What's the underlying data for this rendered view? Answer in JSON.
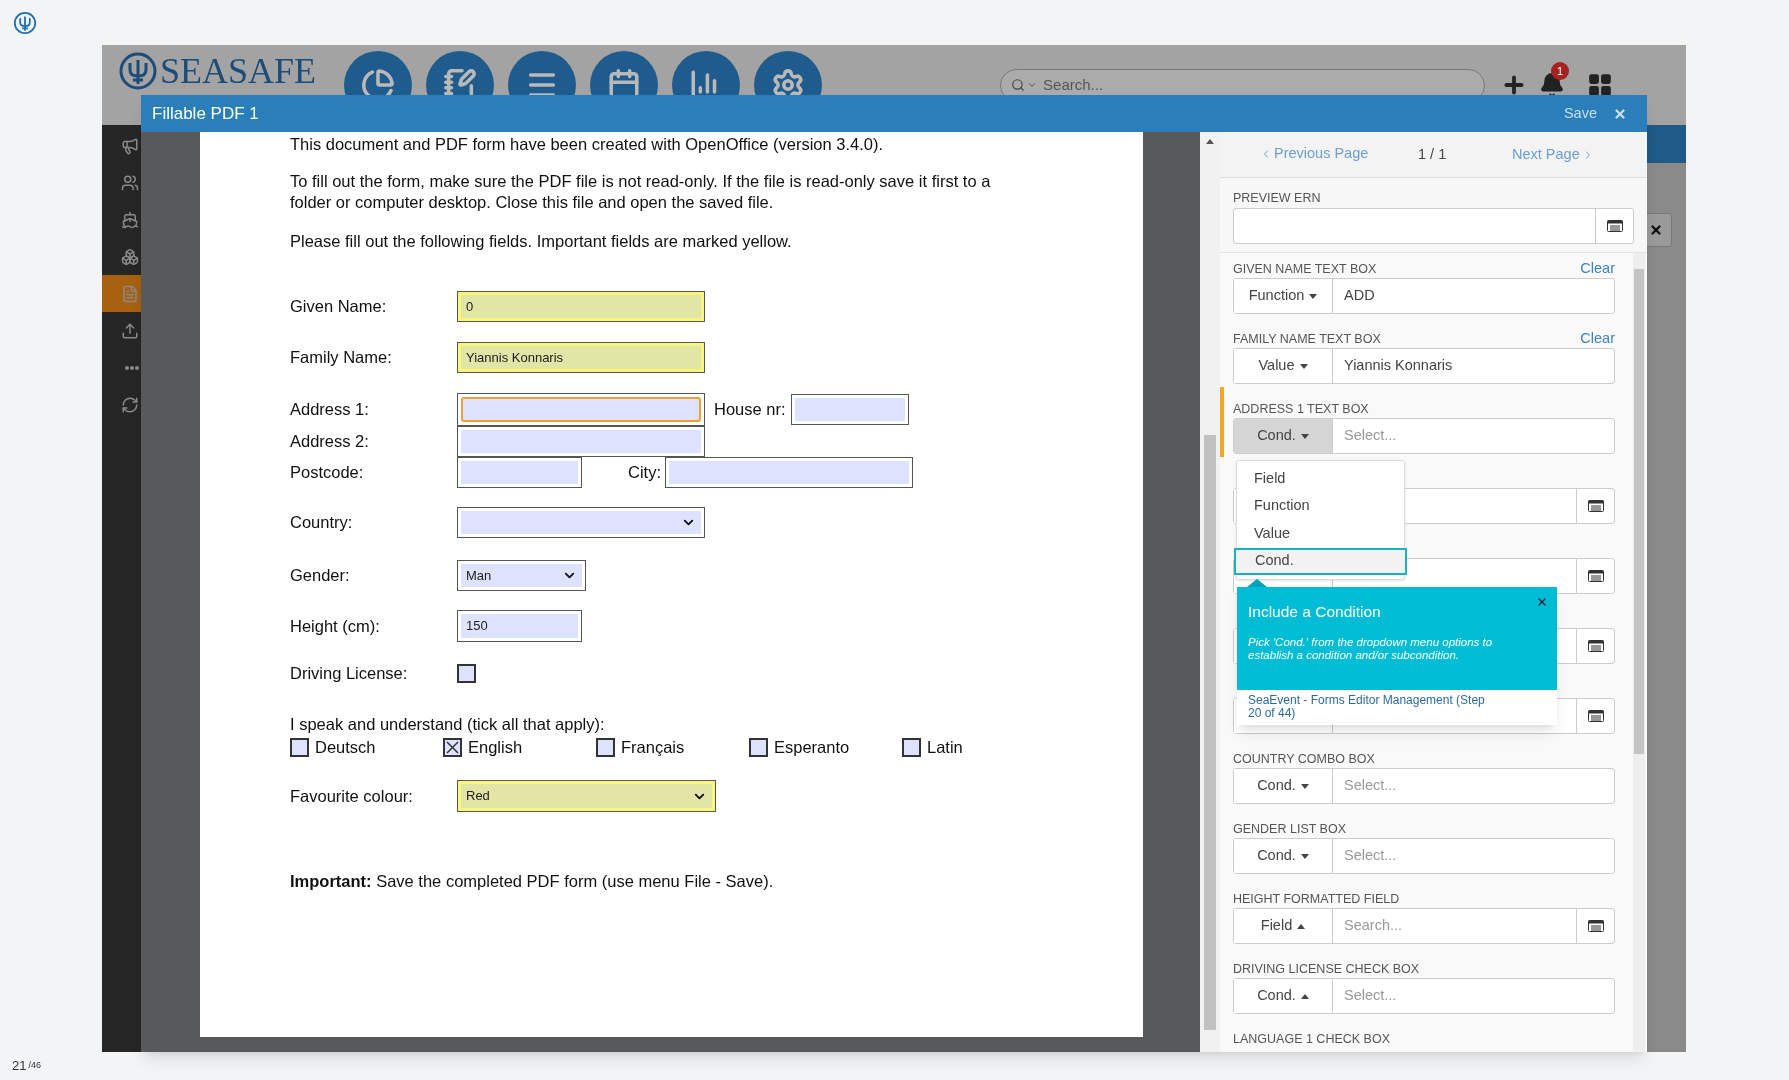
{
  "app_header": {
    "logo_text": "SEASAFE",
    "search": {
      "placeholder": "Search..."
    },
    "notification_count": "1"
  },
  "sidebar": {
    "items": [
      {
        "selected": false
      },
      {
        "selected": false
      },
      {
        "selected": false
      },
      {
        "selected": false
      },
      {
        "selected": true
      },
      {
        "selected": false
      },
      {
        "selected": false
      },
      {
        "selected": false
      }
    ]
  },
  "modal": {
    "title": "Fillable PDF 1",
    "save_label": "Save"
  },
  "document": {
    "intro": [
      "This document and PDF form have been created with OpenOffice (version 3.4.0).",
      "To fill out the form, make sure the PDF file is not read-only. If the file is read-only save it first to a folder or computer desktop. Close this file and open the saved file.",
      "Please fill out the following fields. Important fields are marked yellow."
    ],
    "given_name": {
      "label": "Given Name:",
      "value": "0",
      "important": true
    },
    "family_name": {
      "label": "Family Name:",
      "value": "Yiannis Konnaris",
      "important": true
    },
    "address_1": {
      "label": "Address 1:",
      "important": false,
      "focused": true
    },
    "house_nr": {
      "label": "House nr:",
      "important": false
    },
    "address_2": {
      "label": "Address 2:",
      "important": false
    },
    "postcode": {
      "label": "Postcode:",
      "important": false
    },
    "city": {
      "label": "City:",
      "important": false
    },
    "country": {
      "label": "Country:",
      "important": false
    },
    "gender": {
      "label": "Gender:",
      "value": "Man",
      "important": false
    },
    "height": {
      "label": "Height (cm):",
      "value": "150",
      "important": false
    },
    "driving_license": {
      "label": "Driving License:",
      "checked": false
    },
    "languages_prompt": "I speak and understand (tick all that apply):",
    "languages": [
      {
        "label": "Deutsch",
        "checked": false
      },
      {
        "label": "English",
        "checked": true
      },
      {
        "label": "Français",
        "checked": false
      },
      {
        "label": "Esperanto",
        "checked": false
      },
      {
        "label": "Latin",
        "checked": false
      }
    ],
    "favourite_colour": {
      "label": "Favourite colour:",
      "value": "Red",
      "important": true
    },
    "footer": "**Important:** Save the completed PDF form (use menu File - Save)."
  },
  "pager": {
    "previous": "Previous Page",
    "position": "1 / 1",
    "next": "Next Page"
  },
  "preview_ern": {
    "label": "PREVIEW ERN"
  },
  "mappings": [
    {
      "kind": "mapping",
      "label": "GIVEN NAME TEXT BOX",
      "mode": "Function",
      "caret_up": false,
      "value": "ADD",
      "clear": "Clear",
      "lookup": false,
      "active": false
    },
    {
      "kind": "mapping",
      "label": "FAMILY NAME TEXT BOX",
      "mode": "Value",
      "caret_up": false,
      "value": "Yiannis Konnaris",
      "clear": "Clear",
      "lookup": false,
      "active": false
    },
    {
      "kind": "mapping",
      "label": "ADDRESS 1 TEXT BOX",
      "mode": "Cond.",
      "caret_up": false,
      "placeholder": "Select...",
      "lookup": false,
      "active": true
    },
    {
      "kind": "covered",
      "lookup": true,
      "active": false
    },
    {
      "kind": "covered",
      "lookup": true,
      "active": false
    },
    {
      "kind": "covered",
      "lookup": true,
      "active": false
    },
    {
      "kind": "covered",
      "lookup": true,
      "active": false
    },
    {
      "kind": "mapping",
      "label": "COUNTRY COMBO BOX",
      "mode": "Cond.",
      "caret_up": false,
      "placeholder": "Select...",
      "lookup": false,
      "active": false
    },
    {
      "kind": "mapping",
      "label": "GENDER LIST BOX",
      "mode": "Cond.",
      "caret_up": false,
      "placeholder": "Select...",
      "lookup": false,
      "active": false
    },
    {
      "kind": "mapping",
      "label": "HEIGHT FORMATTED FIELD",
      "mode": "Field",
      "caret_up": true,
      "placeholder": "Search...",
      "lookup": true,
      "active": false
    },
    {
      "kind": "mapping",
      "label": "DRIVING LICENSE CHECK BOX",
      "mode": "Cond.",
      "caret_up": true,
      "placeholder": "Select...",
      "lookup": false,
      "active": false
    },
    {
      "kind": "heading",
      "label": "LANGUAGE 1 CHECK BOX"
    }
  ],
  "dropdown": {
    "options": [
      {
        "label": "Field",
        "selected": false
      },
      {
        "label": "Function",
        "selected": false
      },
      {
        "label": "Value",
        "selected": false
      },
      {
        "label": "Cond.",
        "selected": true
      }
    ]
  },
  "tour_tip": {
    "title": "Include a Condition",
    "body": "Pick 'Cond.' from the dropdown menu options to establish a condition and/or subcondition.",
    "footer": "SeaEvent - Forms Editor Management (Step 20 of 44)"
  },
  "slide_counter": {
    "current": "21",
    "total": "/46"
  }
}
